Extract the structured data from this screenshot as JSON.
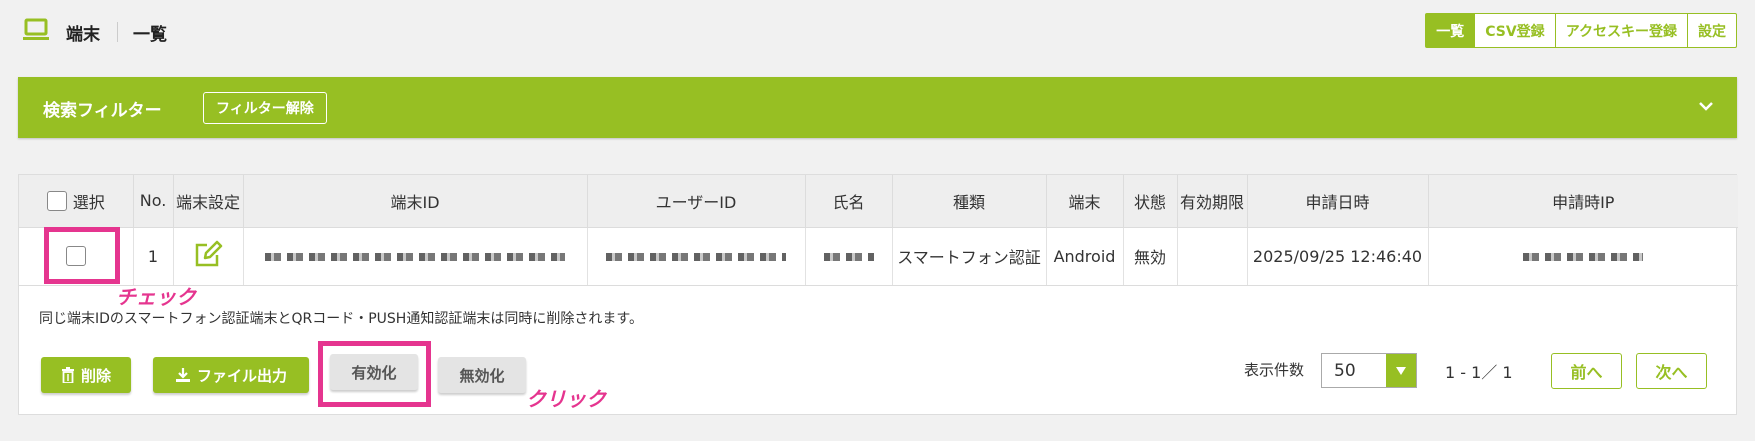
{
  "header": {
    "title": "端末",
    "subtitle": "一覧",
    "tabs": [
      "一覧",
      "CSV登録",
      "アクセスキー登録",
      "設定"
    ],
    "active_tab": "一覧"
  },
  "filter": {
    "title": "検索フィルター",
    "clear_label": "フィルター解除"
  },
  "table": {
    "columns": [
      "選択",
      "No.",
      "端末設定",
      "端末ID",
      "ユーザーID",
      "氏名",
      "種類",
      "端末",
      "状態",
      "有効期限",
      "申請日時",
      "申請時IP"
    ],
    "rows": [
      {
        "no": "1",
        "device_id": "",
        "user_id": "",
        "name": "",
        "type": "スマートフォン認証",
        "device": "Android",
        "status": "無効",
        "expiry": "",
        "applied_at": "2025/09/25 12:46:40",
        "applied_ip": ""
      }
    ]
  },
  "note": "同じ端末IDのスマートフォン認証端末とQRコード・PUSH通知認証端末は同時に削除されます。",
  "actions": {
    "delete": "削除",
    "export": "ファイル出力",
    "enable": "有効化",
    "disable": "無効化"
  },
  "pagination": {
    "per_page_label": "表示件数",
    "per_page_value": "50",
    "range": "1 - 1／ 1",
    "prev": "前へ",
    "next": "次へ"
  },
  "annotations": {
    "check": "チェック",
    "click": "クリック"
  },
  "colors": {
    "accent": "#97bf23",
    "highlight": "#e5358f"
  }
}
